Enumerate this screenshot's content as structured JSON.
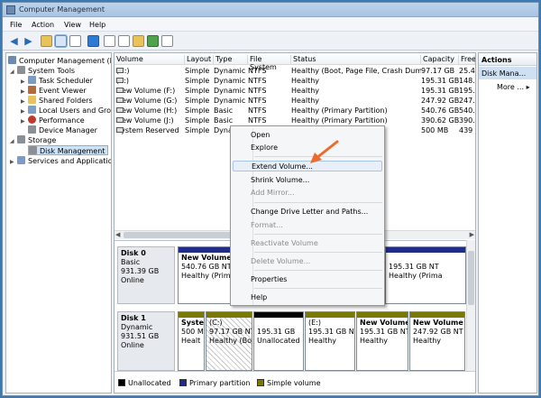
{
  "window": {
    "title": "Computer Management"
  },
  "menu": [
    "File",
    "Action",
    "View",
    "Help"
  ],
  "tree": {
    "root": "Computer Management (L",
    "system_tools": "System Tools",
    "task_scheduler": "Task Scheduler",
    "event_viewer": "Event Viewer",
    "shared_folders": "Shared Folders",
    "local_users": "Local Users and Gro",
    "performance": "Performance",
    "device_manager": "Device Manager",
    "storage": "Storage",
    "disk_management": "Disk Management",
    "services": "Services and Applicatio"
  },
  "list": {
    "headers": [
      "Volume",
      "Layout",
      "Type",
      "File System",
      "Status",
      "Capacity",
      "Free"
    ],
    "rows": [
      [
        "(C:)",
        "Simple",
        "Dynamic",
        "NTFS",
        "Healthy (Boot, Page File, Crash Dump)",
        "97.17 GB",
        "25.4"
      ],
      [
        "(E:)",
        "Simple",
        "Dynamic",
        "NTFS",
        "Healthy",
        "195.31 GB",
        "148."
      ],
      [
        "New Volume (F:)",
        "Simple",
        "Dynamic",
        "NTFS",
        "Healthy",
        "195.31 GB",
        "195."
      ],
      [
        "New Volume (G:)",
        "Simple",
        "Dynamic",
        "NTFS",
        "Healthy",
        "247.92 GB",
        "247."
      ],
      [
        "New Volume (H:)",
        "Simple",
        "Basic",
        "NTFS",
        "Healthy (Primary Partition)",
        "540.76 GB",
        "540."
      ],
      [
        "New Volume (J:)",
        "Simple",
        "Basic",
        "NTFS",
        "Healthy (Primary Partition)",
        "390.62 GB",
        "390."
      ],
      [
        "System Reserved",
        "Simple",
        "Dyna",
        "",
        "",
        "500 MB",
        "439"
      ]
    ]
  },
  "disk0": {
    "name": "Disk 0",
    "type": "Basic",
    "size": "931.39 GB",
    "state": "Online",
    "partition": {
      "title": "New Volume (",
      "line1": "540.76 GB NTFS",
      "line2": "Healthy (Primar"
    },
    "extra": {
      "line1": "195.31 GB NT",
      "line2": "Healthy (Prima"
    }
  },
  "disk1": {
    "name": "Disk 1",
    "type": "Dynamic",
    "size": "931.51 GB",
    "state": "Online",
    "partitions": [
      {
        "title": "Syste",
        "line1": "500 M",
        "line2": "Healt"
      },
      {
        "title": "(C:)",
        "line1": "97.17 GB NT",
        "line2": "Healthy (Boo"
      },
      {
        "title": "",
        "line1": "195.31 GB",
        "line2": "Unallocated"
      },
      {
        "title": "(E:)",
        "line1": "195.31 GB NT",
        "line2": "Healthy"
      },
      {
        "title": "New Volume",
        "line1": "195.31 GB NT",
        "line2": "Healthy"
      },
      {
        "title": "New Volume",
        "line1": "247.92 GB NT",
        "line2": "Healthy"
      }
    ]
  },
  "legend": [
    "Unallocated",
    "Primary partition",
    "Simple volume"
  ],
  "actions": {
    "header": "Actions",
    "item": "Disk Mana...",
    "more": "More ..."
  },
  "context_menu": [
    {
      "label": "Open",
      "disabled": false
    },
    {
      "label": "Explore",
      "disabled": false
    },
    {
      "label": "Extend Volume...",
      "disabled": false
    },
    {
      "label": "Shrink Volume...",
      "disabled": false
    },
    {
      "label": "Add Mirror...",
      "disabled": true
    },
    {
      "label": "Change Drive Letter and Paths...",
      "disabled": false
    },
    {
      "label": "Format...",
      "disabled": true
    },
    {
      "label": "Reactivate Volume",
      "disabled": true
    },
    {
      "label": "Delete Volume...",
      "disabled": true
    },
    {
      "label": "Properties",
      "disabled": false
    },
    {
      "label": "Help",
      "disabled": false
    }
  ],
  "colors": {
    "accent": "#2b6ab0",
    "primary_partition": "#1f2d8a",
    "simple_volume": "#7a7a00",
    "unallocated": "#000000",
    "arrow": "#ee6a2a"
  }
}
